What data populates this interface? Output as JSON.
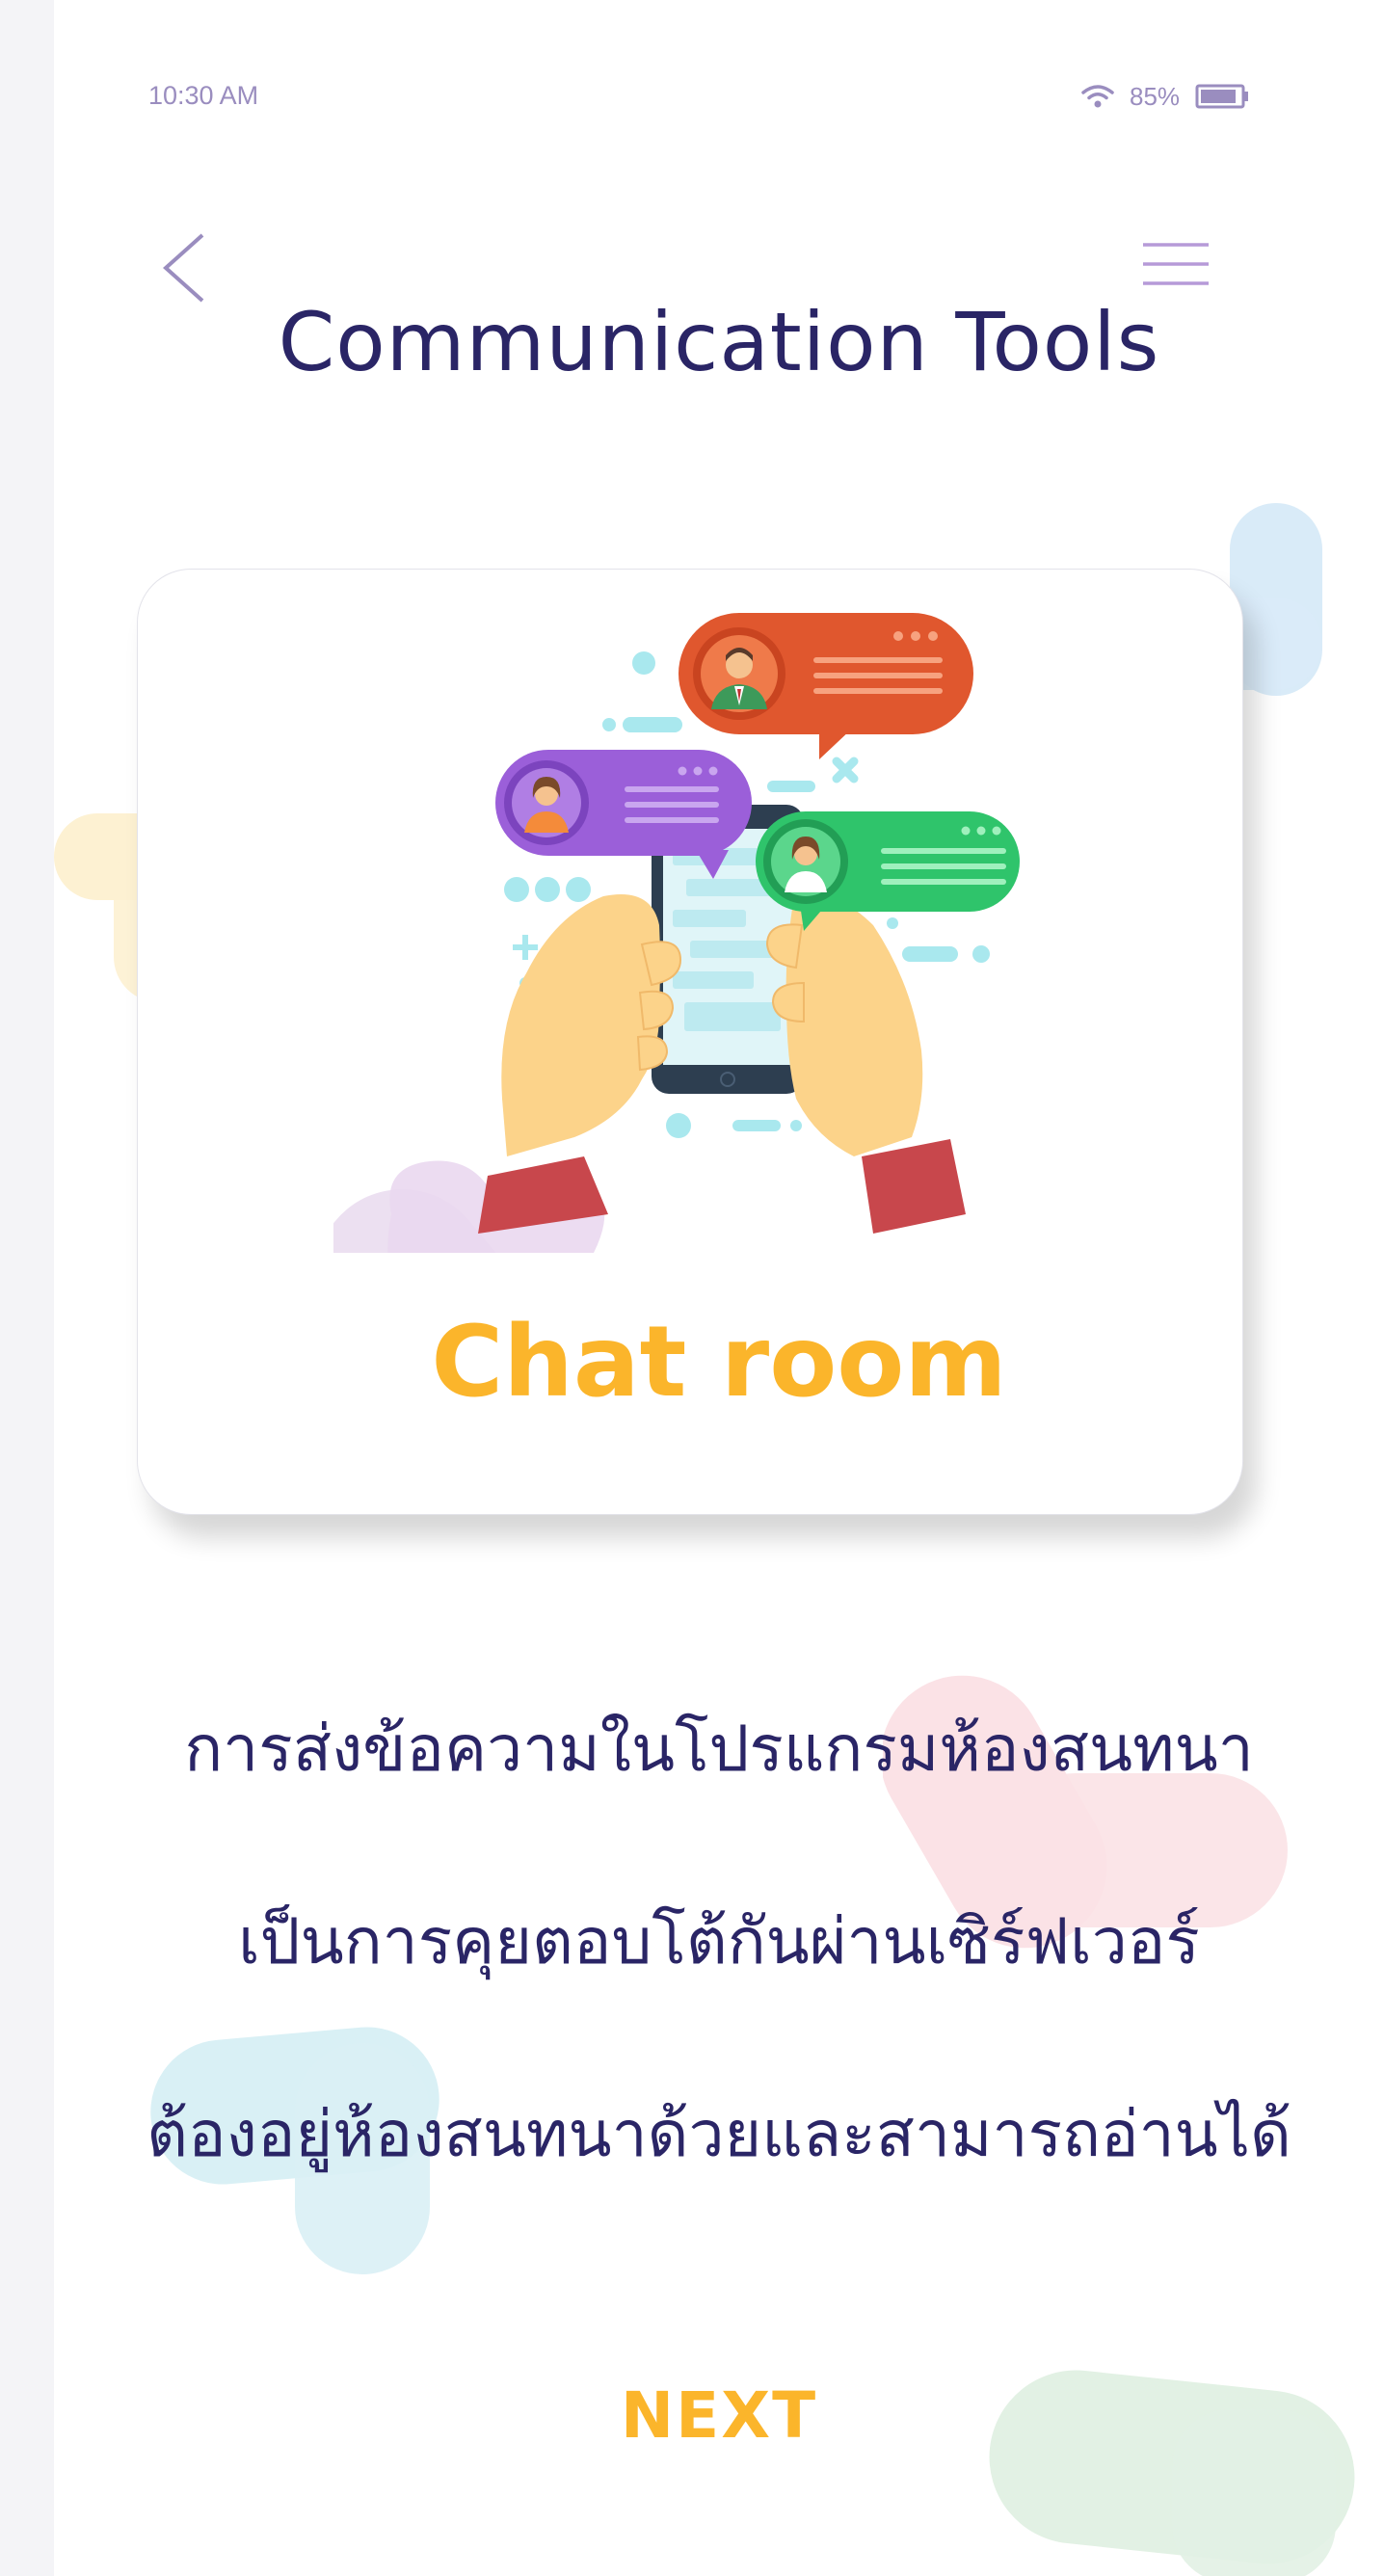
{
  "status_bar": {
    "time": "10:30 AM",
    "battery": "85%"
  },
  "header": {
    "title": "Communication Tools"
  },
  "card": {
    "label": "Chat room"
  },
  "description": {
    "line1": "การส่งข้อความในโปรแกรมห้องสนทนา",
    "line2": "เป็นการคุยตอบโต้กันผ่านเซิร์ฟเวอร์",
    "line3": "ต้องอยู่ห้องสนทนาด้วยและสามารถอ่านได้"
  },
  "footer": {
    "next_label": "NEXT"
  },
  "colors": {
    "title": "#2a2566",
    "accent": "#fbb52b",
    "icon": "#9a8dbf",
    "bubble_red": "#e0572e",
    "bubble_purple": "#9b5fd9",
    "bubble_green": "#2fc46b"
  }
}
